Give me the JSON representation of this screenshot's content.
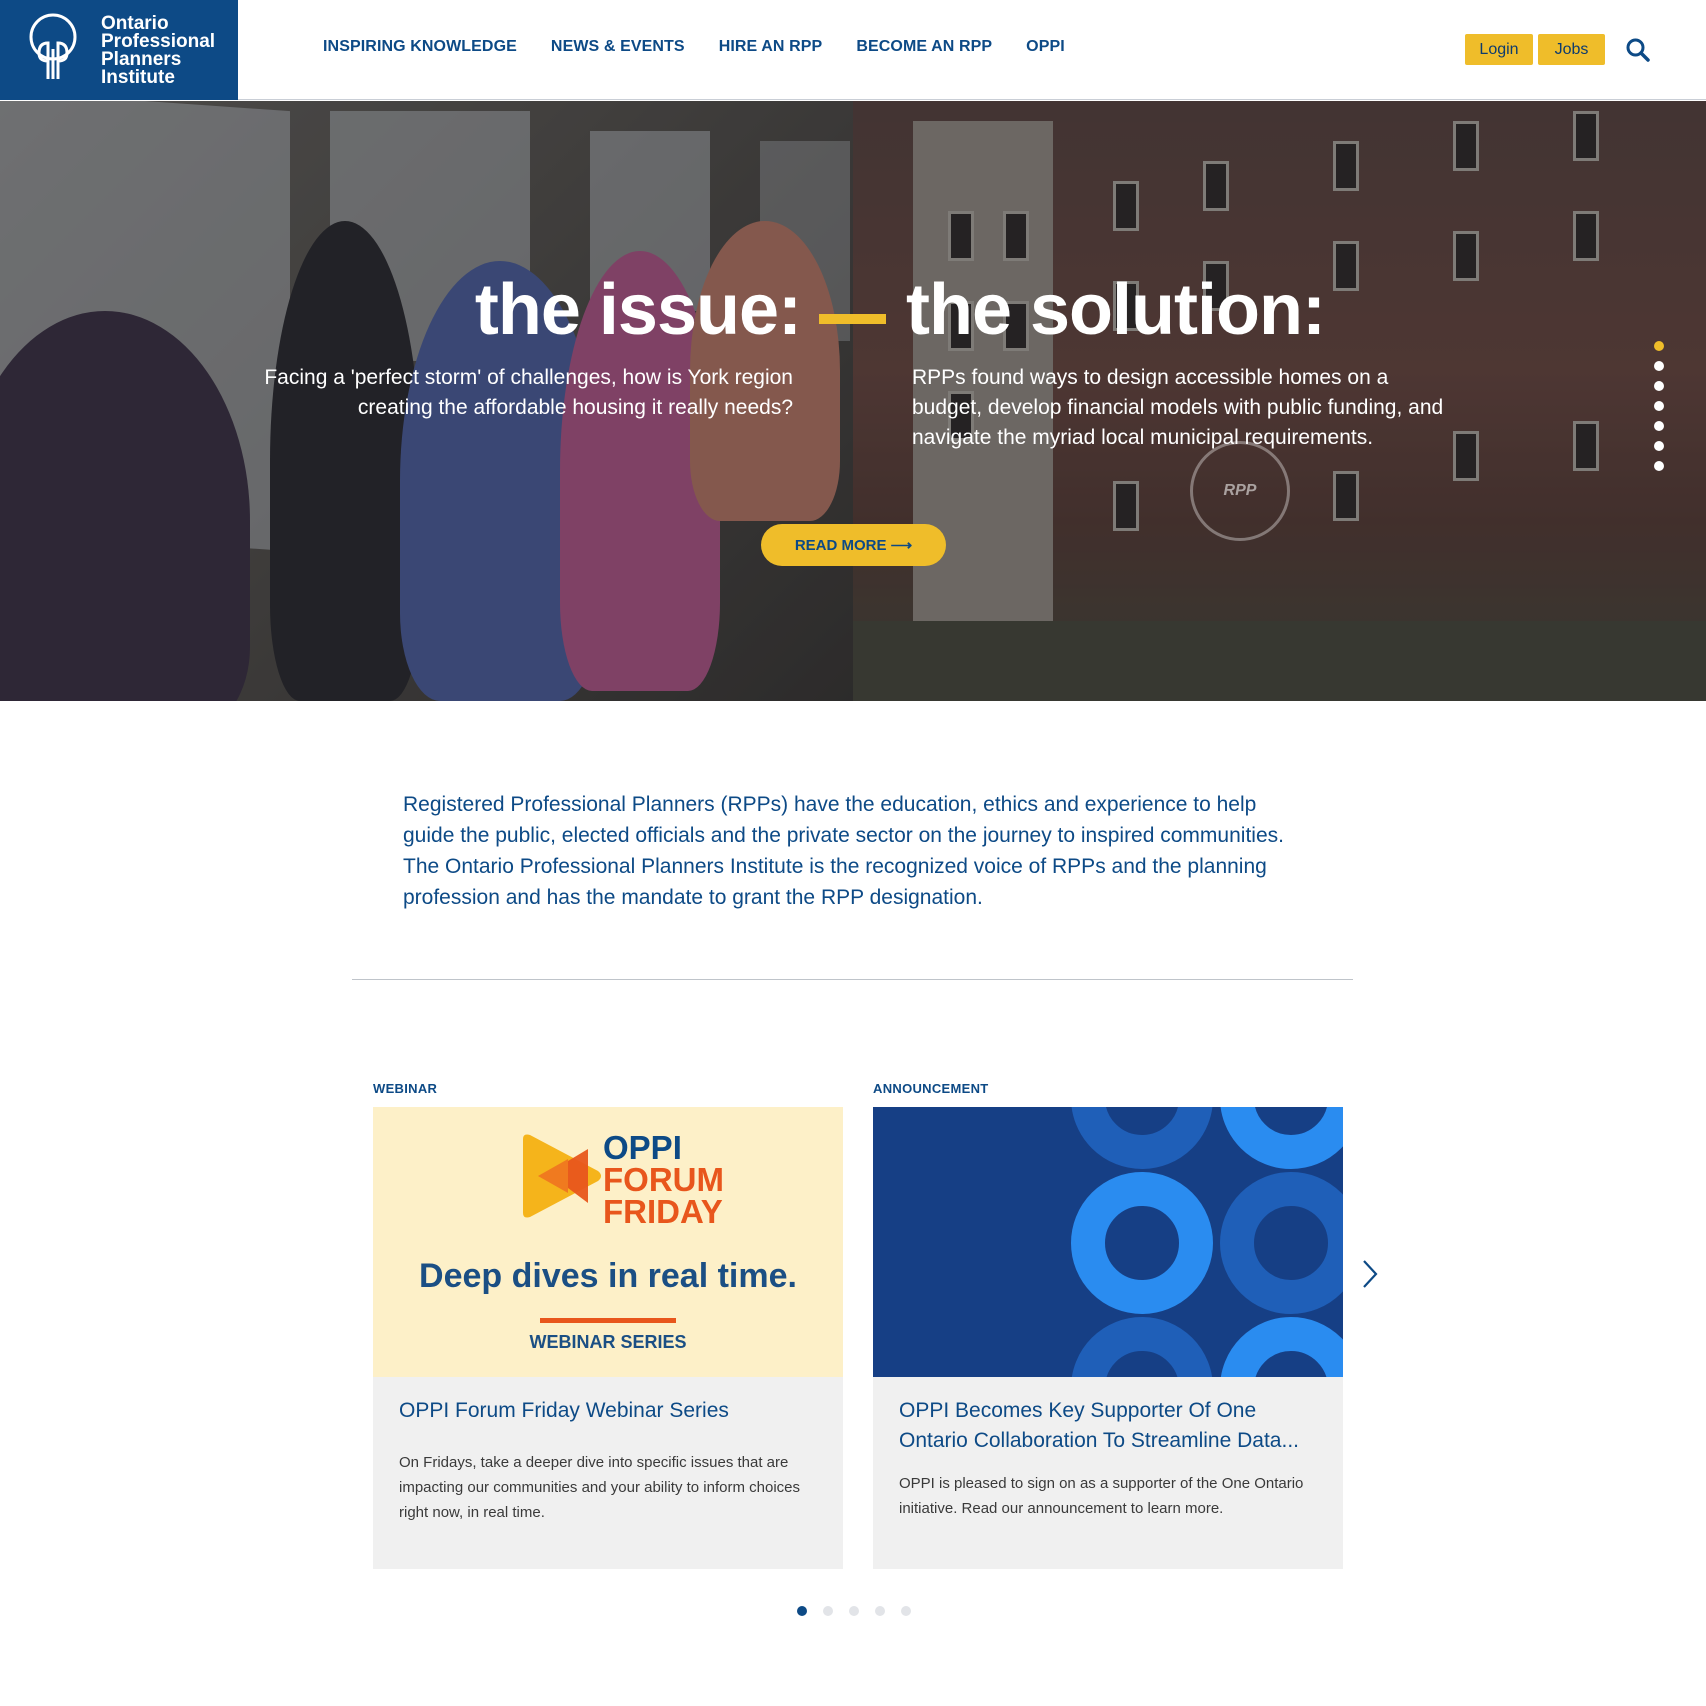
{
  "logo": {
    "line1": "Ontario",
    "line2": "Professional",
    "line3": "Planners",
    "line4": "Institute"
  },
  "nav": {
    "items": [
      {
        "label": "INSPIRING KNOWLEDGE"
      },
      {
        "label": "NEWS & EVENTS"
      },
      {
        "label": "HIRE AN RPP"
      },
      {
        "label": "BECOME AN RPP"
      },
      {
        "label": "OPPI"
      }
    ],
    "login_label": "Login",
    "jobs_label": "Jobs"
  },
  "hero": {
    "title_left": "the issue:",
    "title_right": "the solution:",
    "sub_left": "Facing a 'perfect storm' of challenges, how is York region creating the affordable housing it really needs?",
    "sub_right": "RPPs found ways to design accessible homes on a budget, develop financial models with public funding, and navigate the myriad local municipal requirements.",
    "read_more": "READ MORE ⟶",
    "seal_text": "RPP",
    "slide_count": 7,
    "active_slide": 1
  },
  "intro": {
    "text": "Registered Professional Planners (RPPs) have the education, ethics and experience to help guide the public, elected officials and the private sector on the journey to inspired communities. The Ontario Professional Planners Institute is the recognized voice of RPPs and the planning profession and has the mandate to grant the RPP designation."
  },
  "cards": [
    {
      "category": "WEBINAR",
      "title": "OPPI Forum Friday Webinar Series",
      "description": "On Fridays, take a deeper dive into specific issues that are impacting our communities and your ability to inform choices right now, in real time.",
      "image": {
        "line1": "OPPI",
        "line2": "FORUM",
        "line3": "FRIDAY",
        "tagline": "Deep dives in real time.",
        "series": "WEBINAR SERIES"
      }
    },
    {
      "category": "ANNOUNCEMENT",
      "title": "OPPI Becomes Key Supporter Of One Ontario Collaboration To Streamline Data...",
      "description": "OPPI is pleased to sign on as a supporter of the One Ontario initiative. Read our announcement to learn more."
    }
  ],
  "carousel": {
    "dot_count": 5,
    "active_dot": 1
  },
  "colors": {
    "brand_blue": "#0d4a86",
    "accent_yellow": "#efbd2a",
    "forum_orange": "#e8561c"
  }
}
